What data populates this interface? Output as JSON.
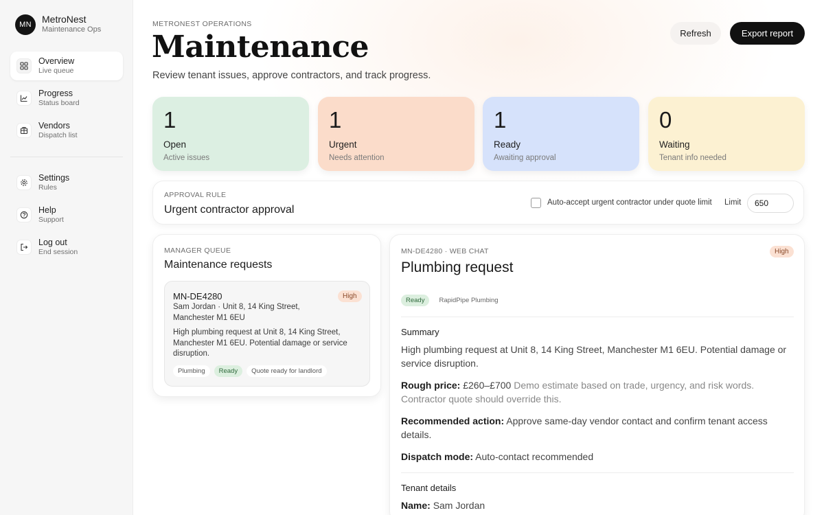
{
  "brand": {
    "initials": "MN",
    "name": "MetroNest",
    "sub": "Maintenance Ops"
  },
  "nav": {
    "primary": [
      {
        "label": "Overview",
        "sub": "Live queue",
        "icon": "grid-icon"
      },
      {
        "label": "Progress",
        "sub": "Status board",
        "icon": "chart-icon"
      },
      {
        "label": "Vendors",
        "sub": "Dispatch list",
        "icon": "building-icon"
      }
    ],
    "secondary": [
      {
        "label": "Settings",
        "sub": "Rules",
        "icon": "gear-icon"
      },
      {
        "label": "Help",
        "sub": "Support",
        "icon": "help-icon"
      },
      {
        "label": "Log out",
        "sub": "End session",
        "icon": "logout-icon"
      }
    ]
  },
  "header": {
    "eyebrow": "METRONEST OPERATIONS",
    "title": "Maintenance",
    "subtitle": "Review tenant issues, approve contractors, and track progress.",
    "refresh_label": "Refresh",
    "export_label": "Export report"
  },
  "stats": [
    {
      "value": "1",
      "label": "Open",
      "sub": "Active issues",
      "color": "#dcefe2"
    },
    {
      "value": "1",
      "label": "Urgent",
      "sub": "Needs attention",
      "color": "#fbdcca"
    },
    {
      "value": "1",
      "label": "Ready",
      "sub": "Awaiting approval",
      "color": "#d6e2fb"
    },
    {
      "value": "0",
      "label": "Waiting",
      "sub": "Tenant info needed",
      "color": "#fcf1d2"
    }
  ],
  "rule": {
    "eyebrow": "APPROVAL RULE",
    "title": "Urgent contractor approval",
    "checkbox_label": "Auto-accept urgent contractor under quote limit",
    "limit_label": "Limit",
    "limit_value": "650"
  },
  "queue": {
    "eyebrow": "MANAGER QUEUE",
    "title": "Maintenance requests",
    "item": {
      "id": "MN-DE4280",
      "badge": "High",
      "address": "Sam Jordan · Unit 8, 14 King Street, Manchester M1 6EU",
      "description": "High plumbing request at Unit 8, 14 King Street, Manchester M1 6EU. Potential damage or service disruption.",
      "tags": [
        "Plumbing",
        "Ready",
        "Quote ready for landlord"
      ]
    }
  },
  "detail": {
    "eyebrow": "MN-DE4280 · WEB CHAT",
    "title": "Plumbing request",
    "badge": "High",
    "status": "Ready",
    "vendor": "RapidPipe Plumbing",
    "summary_heading": "Summary",
    "summary": "High plumbing request at Unit 8, 14 King Street, Manchester M1 6EU. Potential damage or service disruption.",
    "price_label": "Rough price:",
    "price_value": "£260–£700",
    "price_note": "Demo estimate based on trade, urgency, and risk words. Contractor quote should override this.",
    "action_label": "Recommended action:",
    "action_value": "Approve same-day vendor contact and confirm tenant access details.",
    "dispatch_label": "Dispatch mode:",
    "dispatch_value": "Auto-contact recommended",
    "tenant_heading": "Tenant details",
    "name_label": "Name:",
    "name_value": "Sam Jordan"
  }
}
